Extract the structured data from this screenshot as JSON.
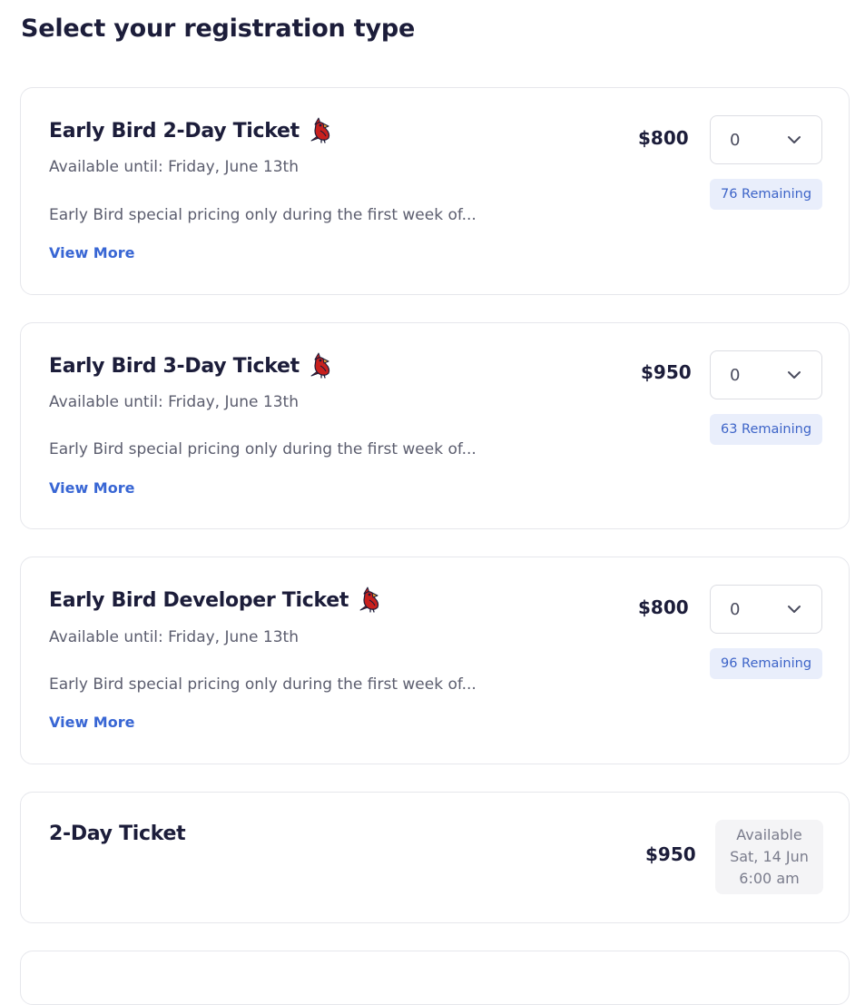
{
  "page": {
    "title": "Select your registration type"
  },
  "tickets": [
    {
      "title": "Early Bird 2-Day Ticket",
      "icon": "cardinal-bird-icon",
      "available_until": "Available until: Friday, June 13th",
      "description": "Early Bird special pricing only during the first week of...",
      "view_more": "View More",
      "price": "$800",
      "quantity": "0",
      "remaining": "76 Remaining"
    },
    {
      "title": "Early Bird 3-Day Ticket",
      "icon": "cardinal-bird-icon",
      "available_until": "Available until: Friday, June 13th",
      "description": "Early Bird special pricing only during the first week of...",
      "view_more": "View More",
      "price": "$950",
      "quantity": "0",
      "remaining": "63 Remaining"
    },
    {
      "title": "Early Bird Developer Ticket",
      "icon": "cardinal-bird-icon",
      "available_until": "Available until: Friday, June 13th",
      "description": "Early Bird special pricing only during the first week of...",
      "view_more": "View More",
      "price": "$800",
      "quantity": "0",
      "remaining": "96 Remaining"
    },
    {
      "title": "2-Day Ticket",
      "price": "$950",
      "availability": [
        "Available",
        "Sat, 14 Jun",
        "6:00 am"
      ]
    }
  ],
  "colors": {
    "text": "#1c1d3a",
    "muted": "#5b5d6e",
    "link": "#3866d4",
    "badge_bg": "#e9eefb",
    "badge_text": "#3d64c8",
    "bird": "#c8201e"
  }
}
